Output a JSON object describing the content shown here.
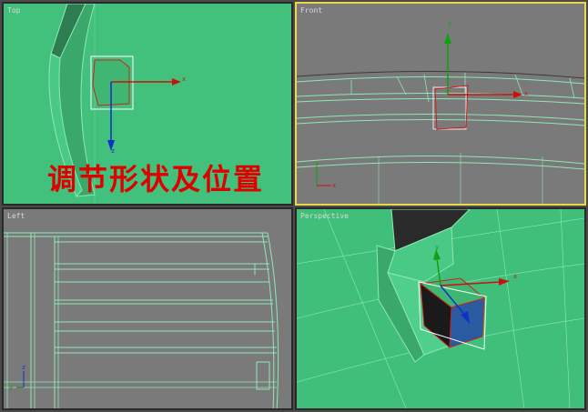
{
  "viewports": {
    "top": {
      "label": "Top",
      "caption": "调节形状及位置"
    },
    "front": {
      "label": "Front",
      "active": true
    },
    "left": {
      "label": "Left"
    },
    "perspective": {
      "label": "Perspective"
    }
  },
  "axis_labels": {
    "x": "x",
    "y": "y",
    "z": "z"
  },
  "colors": {
    "viewport_green": "#3fbf7a",
    "viewport_gray": "#7a7a7a",
    "active_border": "#e8d84a",
    "caption_red": "#e00000",
    "gizmo_red": "#cc1010",
    "gizmo_green": "#10a010",
    "gizmo_blue": "#1030cc"
  }
}
